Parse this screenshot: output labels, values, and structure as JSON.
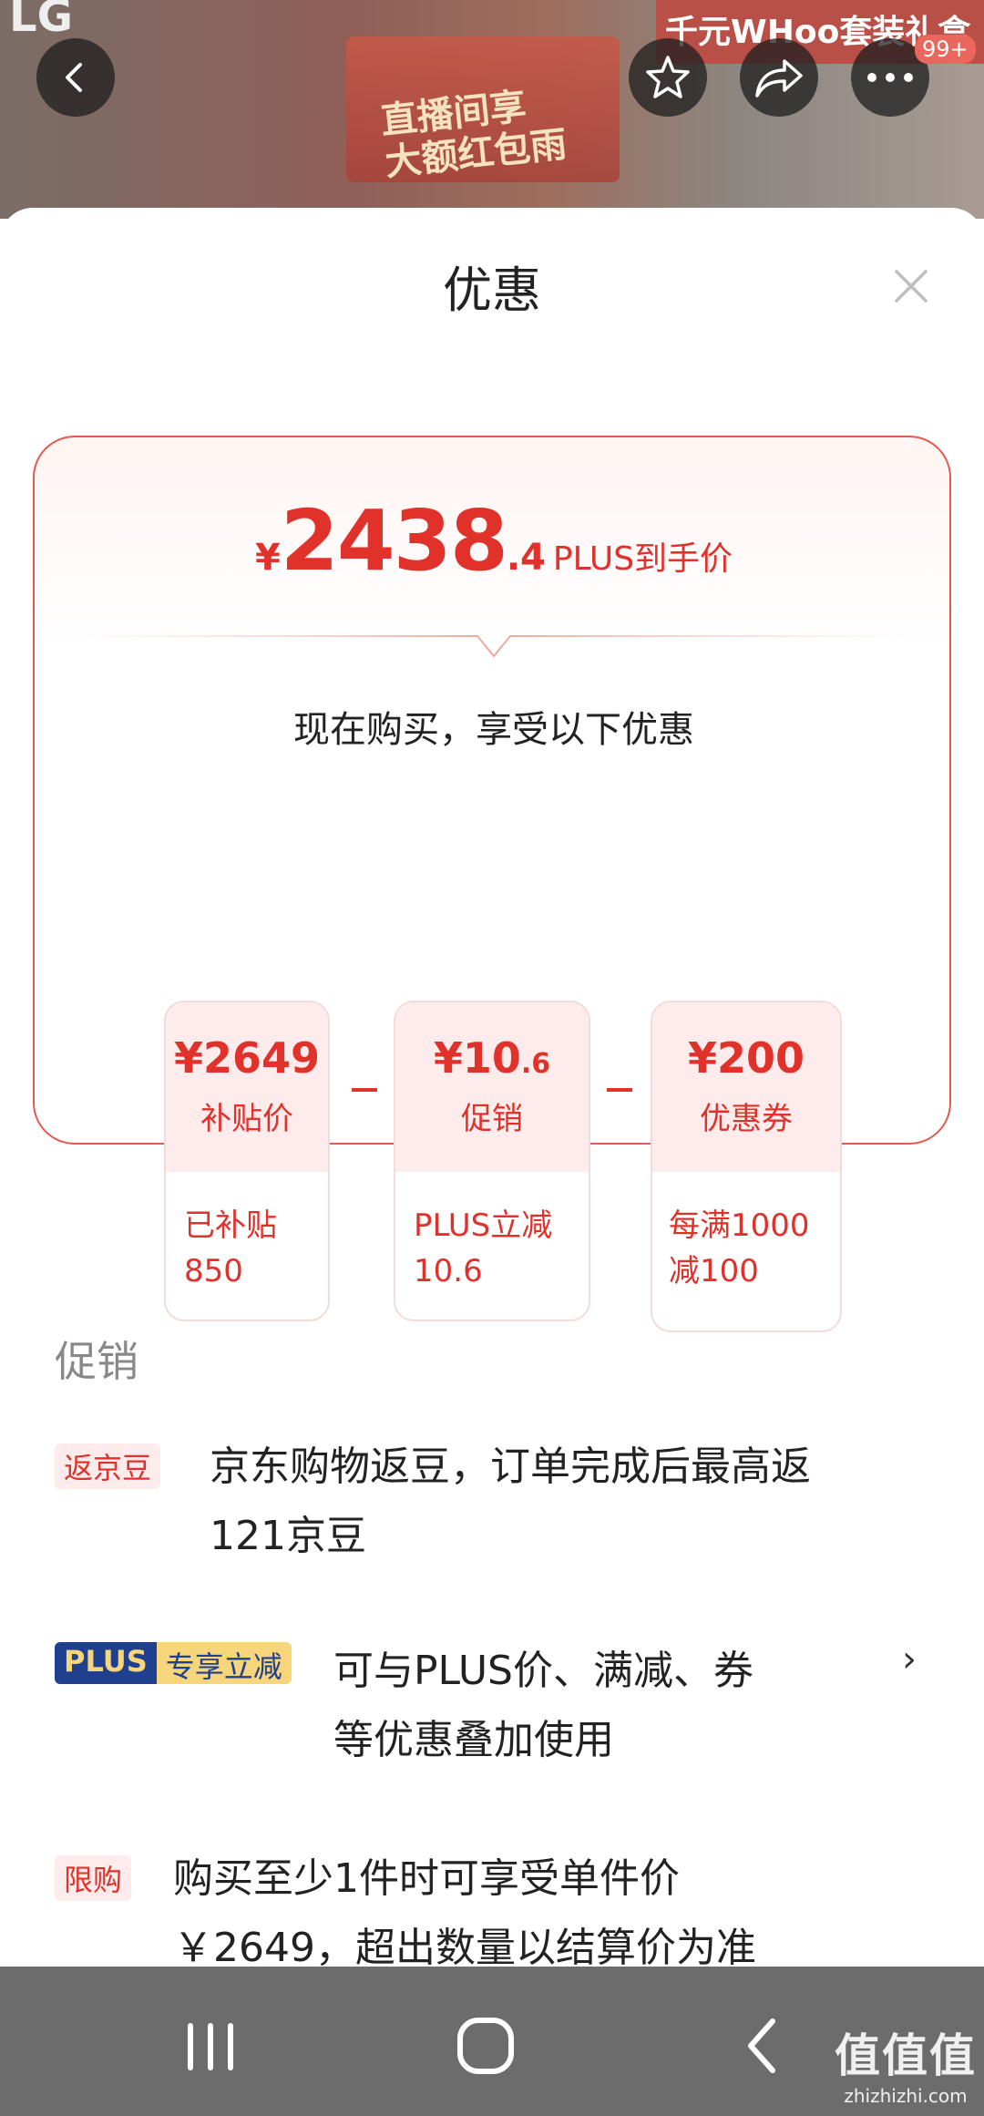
{
  "header": {
    "logo_text": "LG",
    "banner_left": "直播间享\n大额红包雨",
    "banner_right": "千元WHoo套装礼盒",
    "cart_badge": "99+"
  },
  "sheet": {
    "title": "优惠"
  },
  "price_card": {
    "currency": "¥",
    "price_int": "2438",
    "price_dec": ".4",
    "price_label": "PLUS到手价",
    "subtitle": "现在购买，享受以下优惠",
    "deals": [
      {
        "amount": "¥2649",
        "amount_small": "",
        "kind": "补贴价",
        "desc_line1": "已补贴",
        "desc_line2": "850"
      },
      {
        "amount": "¥10",
        "amount_small": ".6",
        "kind": "促销",
        "desc_line1": "PLUS立减",
        "desc_line2": "10.6"
      },
      {
        "amount": "¥200",
        "amount_small": "",
        "kind": "优惠券",
        "desc_line1": "每满1000",
        "desc_line2": "减100"
      }
    ]
  },
  "promotions": {
    "section_title": "促销",
    "items": [
      {
        "tag": "返京豆",
        "line1": "京东购物返豆，订单完成后最高返",
        "line2": "121京豆"
      },
      {
        "tag_a": "PLUS",
        "tag_b": "专享立减",
        "line1": "可与PLUS价、满减、券",
        "line2": "等优惠叠加使用",
        "chevron": "›"
      },
      {
        "tag": "限购",
        "line1": "购买至少1件时可享受单件价",
        "line2": "￥2649，超出数量以结算价为准"
      }
    ]
  },
  "watermark": {
    "line1": "值值值",
    "line2": "zhizhizhi.com"
  }
}
